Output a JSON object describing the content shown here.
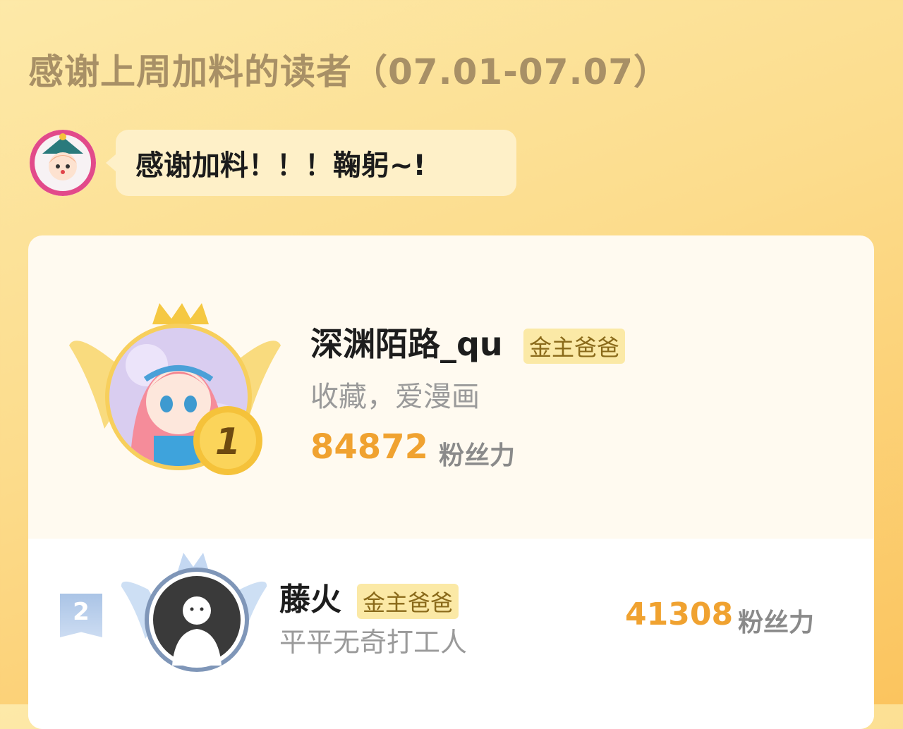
{
  "header": {
    "title": "感谢上周加料的读者（07.01-07.07）"
  },
  "author_message": {
    "text": "感谢加料！！！鞠躬~!"
  },
  "leaderboard": [
    {
      "rank": "1",
      "name": "深渊陌路_qu",
      "badge": "金主爸爸",
      "signature": "收藏，爱漫画",
      "score": "84872",
      "score_unit": "粉丝力"
    },
    {
      "rank": "2",
      "name": "藤火",
      "badge": "金主爸爸",
      "signature": "平平无奇打工人",
      "score": "41308",
      "score_unit": "粉丝力"
    }
  ],
  "colors": {
    "accent_score": "#f0a230",
    "badge_bg": "#fbe9a6",
    "badge_text": "#8a6a1a",
    "gold": "#f5c23a",
    "silver": "#aac4e6"
  },
  "icons": [
    "crown-icon",
    "wings-icon",
    "gold-medal-icon",
    "silver-wings-icon",
    "rank-ribbon-icon"
  ]
}
